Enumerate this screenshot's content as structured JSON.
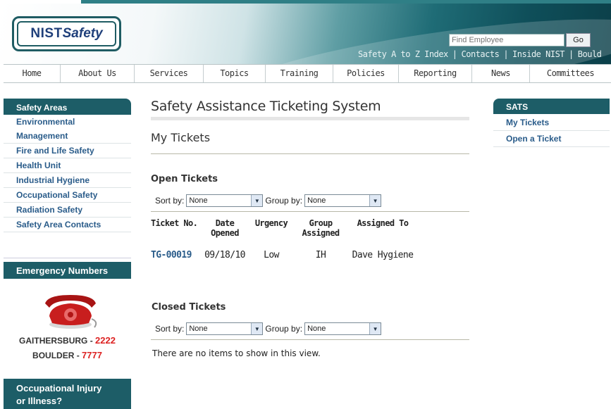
{
  "header": {
    "logo_nist": "NIST",
    "logo_safety": "Safety",
    "find_placeholder": "Find Employee",
    "go_label": "Go",
    "top_links": [
      "Safety A to Z Index",
      "Contacts",
      "Inside NIST",
      "Bould"
    ]
  },
  "nav": {
    "tabs": [
      "Home",
      "About Us",
      "Services",
      "Topics",
      "Training",
      "Policies",
      "Reporting",
      "News",
      "Committees"
    ]
  },
  "sidebar": {
    "title": "Safety Areas",
    "items": [
      "Environmental",
      "Management",
      "Fire and Life Safety",
      "Health Unit",
      "Industrial Hygiene",
      "Occupational Safety",
      "Radiation Safety",
      "Safety Area Contacts"
    ]
  },
  "emergency": {
    "title": "Emergency Numbers",
    "gaithersburg_label": "GAITHERSBURG - ",
    "gaithersburg_number": "2222",
    "boulder_label": "BOULDER - ",
    "boulder_number": "7777"
  },
  "injury": {
    "line1": "Occupational Injury",
    "line2": "or Illness?"
  },
  "main": {
    "title": "Safety Assistance Ticketing System",
    "subtitle": "My Tickets",
    "open": {
      "heading": "Open Tickets",
      "sort_label": "Sort by:",
      "sort_value": "None",
      "group_label": "Group by:",
      "group_value": "None",
      "columns": {
        "ticket_no": "Ticket No.",
        "date_opened_1": "Date",
        "date_opened_2": "Opened",
        "urgency": "Urgency",
        "group_1": "Group",
        "group_2": "Assigned",
        "assigned_to": "Assigned To"
      },
      "rows": [
        {
          "ticket": "TG-00019",
          "date": "09/18/10",
          "urgency": "Low",
          "group": "IH",
          "assigned": "Dave Hygiene"
        }
      ]
    },
    "closed": {
      "heading": "Closed Tickets",
      "sort_label": "Sort by:",
      "sort_value": "None",
      "group_label": "Group by:",
      "group_value": "None",
      "empty_text": "There are no items to show in this view."
    }
  },
  "rsidebar": {
    "title": "SATS",
    "items": [
      "My Tickets",
      "Open a Ticket"
    ]
  }
}
